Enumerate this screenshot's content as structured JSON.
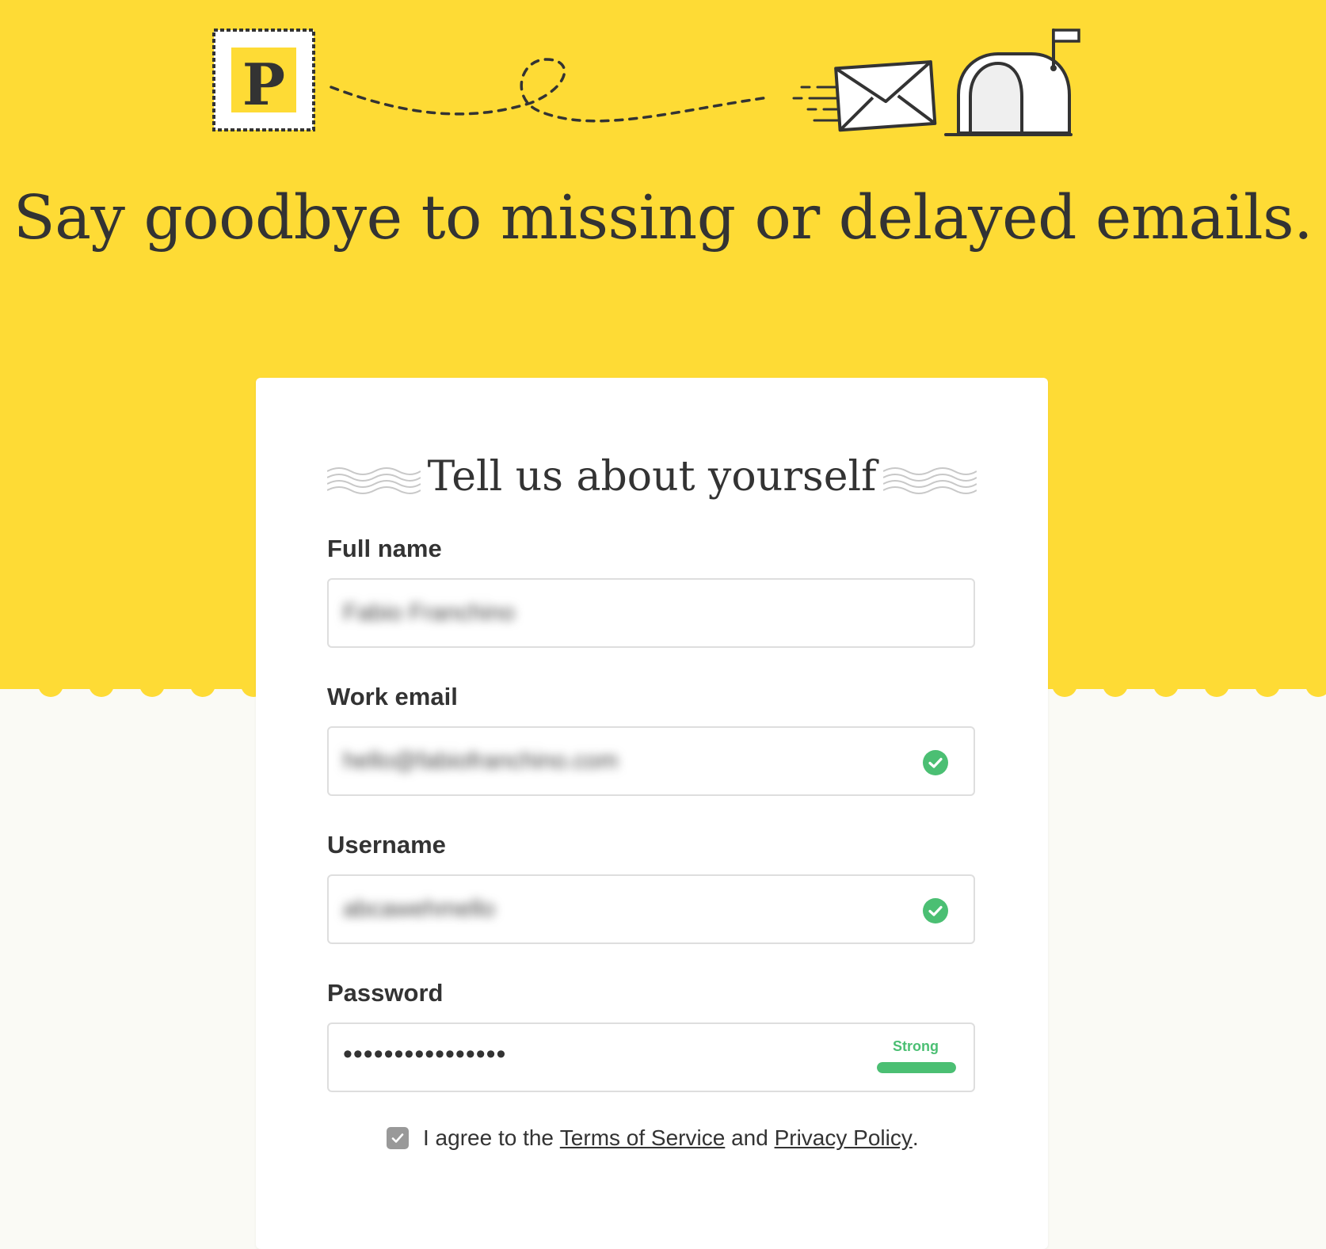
{
  "hero": {
    "stamp_letter": "P",
    "headline": "Say goodbye to missing or delayed emails."
  },
  "form": {
    "title": "Tell us about yourself",
    "full_name": {
      "label": "Full name",
      "value": "Fabio Franchino"
    },
    "work_email": {
      "label": "Work email",
      "value": "hello@fabiofranchino.com",
      "valid": true
    },
    "username": {
      "label": "Username",
      "value": "abcawehmello",
      "valid": true
    },
    "password": {
      "label": "Password",
      "value": "••••••••••••••••",
      "strength_label": "Strong",
      "strength_fraction": 1.0
    },
    "agreement": {
      "checked": true,
      "prefix": "I agree to the ",
      "terms_link": "Terms of Service",
      "middle": " and ",
      "privacy_link": "Privacy Policy",
      "suffix": "."
    }
  },
  "colors": {
    "brand_yellow": "#fedb35",
    "text_dark": "#333333",
    "success_green": "#4bbf73",
    "page_bg": "#fafaf5",
    "checkbox_gray": "#999999"
  },
  "icons": {
    "stamp": "postage-stamp-icon",
    "envelope": "envelope-icon",
    "mailbox": "mailbox-icon",
    "check": "check-circle-icon",
    "checkbox": "checkbox-checked-icon"
  }
}
